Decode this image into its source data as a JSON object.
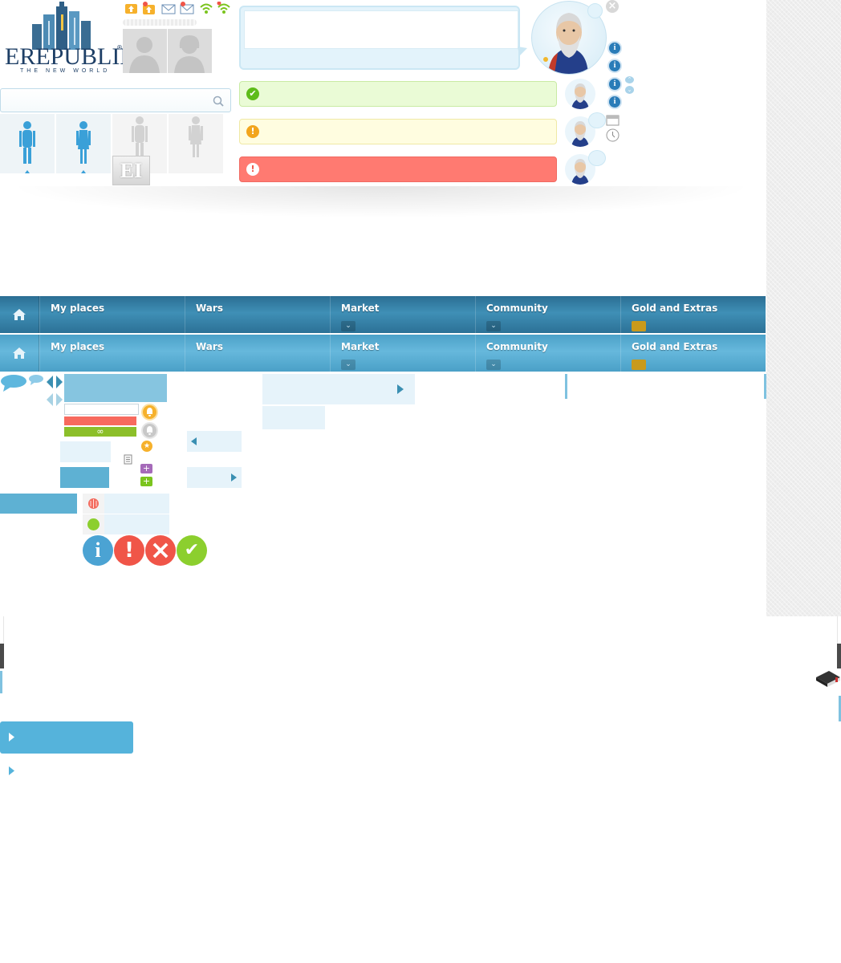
{
  "logo": {
    "word": "EREPUBLIK",
    "registered": "®",
    "tagline": "THE NEW WORLD"
  },
  "header": {
    "icons": [
      "level-up-icon",
      "level-up-star-icon",
      "mail-icon",
      "mail-star-icon",
      "wifi-icon",
      "wifi-star-icon"
    ],
    "avatars": [
      "male-avatar-placeholder",
      "female-avatar-placeholder"
    ]
  },
  "search": {
    "placeholder": ""
  },
  "bodies": [
    "male-body-active",
    "female-body-active",
    "male-body-inactive",
    "female-body-inactive"
  ],
  "ei_badge": "EI",
  "messages": {
    "success": {
      "icon": "✔"
    },
    "warning": {
      "icon": "!"
    },
    "error": {
      "icon": "!"
    }
  },
  "nav": {
    "items": [
      {
        "label": "My places"
      },
      {
        "label": "Wars"
      },
      {
        "label": "Market"
      },
      {
        "label": "Community"
      },
      {
        "label": "Gold and Extras"
      }
    ]
  },
  "progress": {
    "infinity": "∞",
    "red_fill": 1.0,
    "green_fill": 1.0
  },
  "status_icons": {
    "info": "i",
    "alert": "!",
    "close": "×",
    "check": "✔"
  },
  "colors": {
    "nav_dark": "#2b6e93",
    "nav_light": "#55aad0",
    "success": "#7bc41e",
    "warning": "#f2a51c",
    "error": "#f05548",
    "info": "#4ba3d3"
  }
}
